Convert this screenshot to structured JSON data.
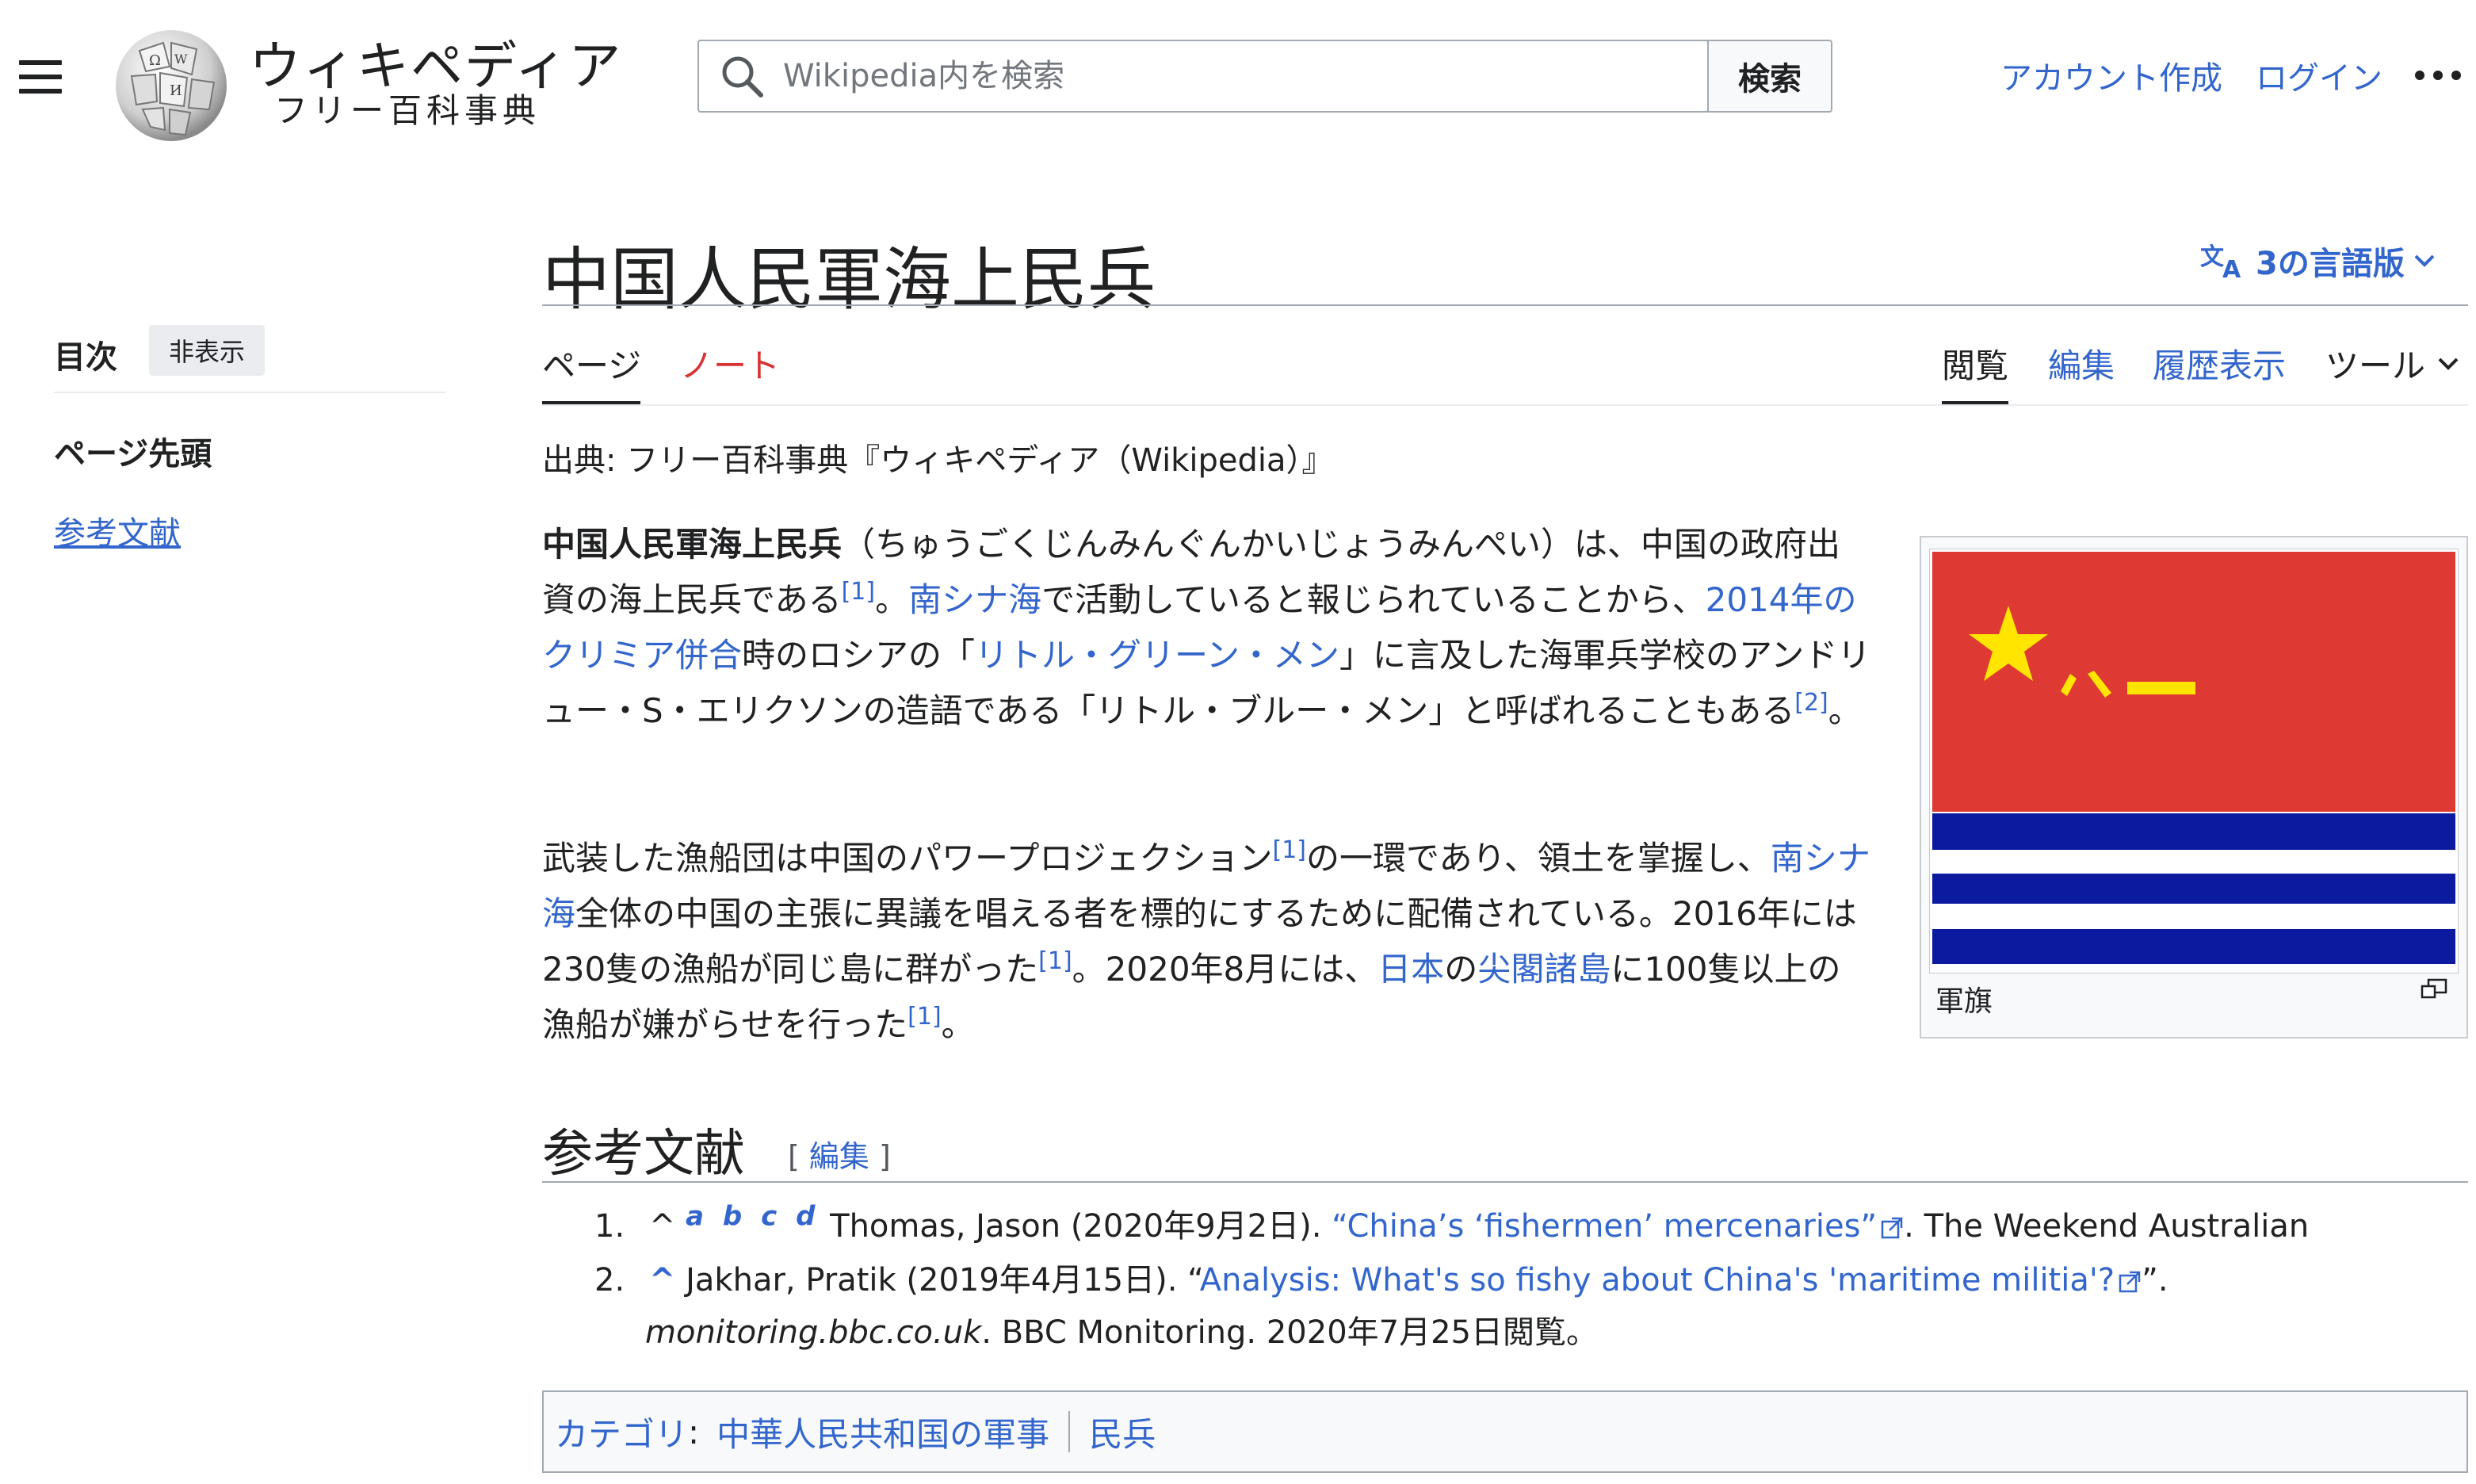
{
  "header": {
    "wordmark": "ウィキペディア",
    "tagline": "フリー百科事典",
    "search_placeholder": "Wikipedia内を検索",
    "search_button": "検索",
    "create_account": "アカウント作成",
    "login": "ログイン"
  },
  "toc": {
    "title": "目次",
    "hide": "非表示",
    "items": [
      "ページ先頭",
      "参考文献"
    ]
  },
  "article": {
    "title": "中国人民軍海上民兵",
    "languages": "3の言語版",
    "tabs": {
      "page": "ページ",
      "talk": "ノート",
      "read": "閲覧",
      "edit": "編集",
      "history": "履歴表示",
      "tools": "ツール"
    },
    "from": "出典: フリー百科事典『ウィキペディア（Wikipedia）』"
  },
  "p1": {
    "bold": "中国人民軍海上民兵",
    "t1": "（ちゅうごくじんみんぐんかいじょうみんぺい）は、中国の政府出資の海上民兵である",
    "ref1": "[1]",
    "t2": "。",
    "link1": "南シナ海",
    "t3": "で活動していると報じられていることから、",
    "link2": "2014年のクリミア併合",
    "t4": "時のロシアの「",
    "link3": "リトル・グリーン・メン",
    "t5": "」に言及した海軍兵学校のアンドリュー・S・エリクソンの造語である「リトル・ブルー・メン」と呼ばれることもある",
    "ref2": "[2]",
    "t6": "。"
  },
  "p2": {
    "t1": "武装した漁船団は中国のパワープロジェクション",
    "ref1": "[1]",
    "t2": "の一環であり、領土を掌握し、",
    "link1": "南シナ海",
    "t3": "全体の中国の主張に異議を唱える者を標的にするために配備されている。2016年には230隻の漁船が同じ島に群がった",
    "ref2": "[1]",
    "t4": "。2020年8月には、",
    "link2": "日本",
    "t5": "の",
    "link3": "尖閣諸島",
    "t6": "に100隻以上の漁船が嫌がらせを行った",
    "ref3": "[1]",
    "t7": "。"
  },
  "infobox": {
    "flag_text": "八一",
    "caption": "軍旗",
    "colors": {
      "red": "#de3a33",
      "yellow": "#ffe500",
      "blue": "#0b1a9e"
    }
  },
  "references": {
    "heading": "参考文献",
    "edit_open": "[ ",
    "edit_label": "編集",
    "edit_close": " ]",
    "items": [
      {
        "num": "1.",
        "caret": "^",
        "letters": "a b c d",
        "pre": "Thomas, Jason (2020年9月2日). ",
        "title": "“China’s ‘fishermen’ mercenaries”",
        "post": ". The Weekend Australian"
      },
      {
        "num": "2.",
        "caret": "^",
        "pre": "Jakhar, Pratik (2019年4月15日). “",
        "title": "Analysis: What's so fishy about China's 'maritime militia'?",
        "post": "”.",
        "line2_italic": "monitoring.bbc.co.uk",
        "line2": ". BBC Monitoring. 2020年7月25日閲覧。"
      }
    ]
  },
  "categories": {
    "label": "カテゴリ",
    "colon": ":",
    "items": [
      "中華人民共和国の軍事",
      "民兵"
    ]
  }
}
